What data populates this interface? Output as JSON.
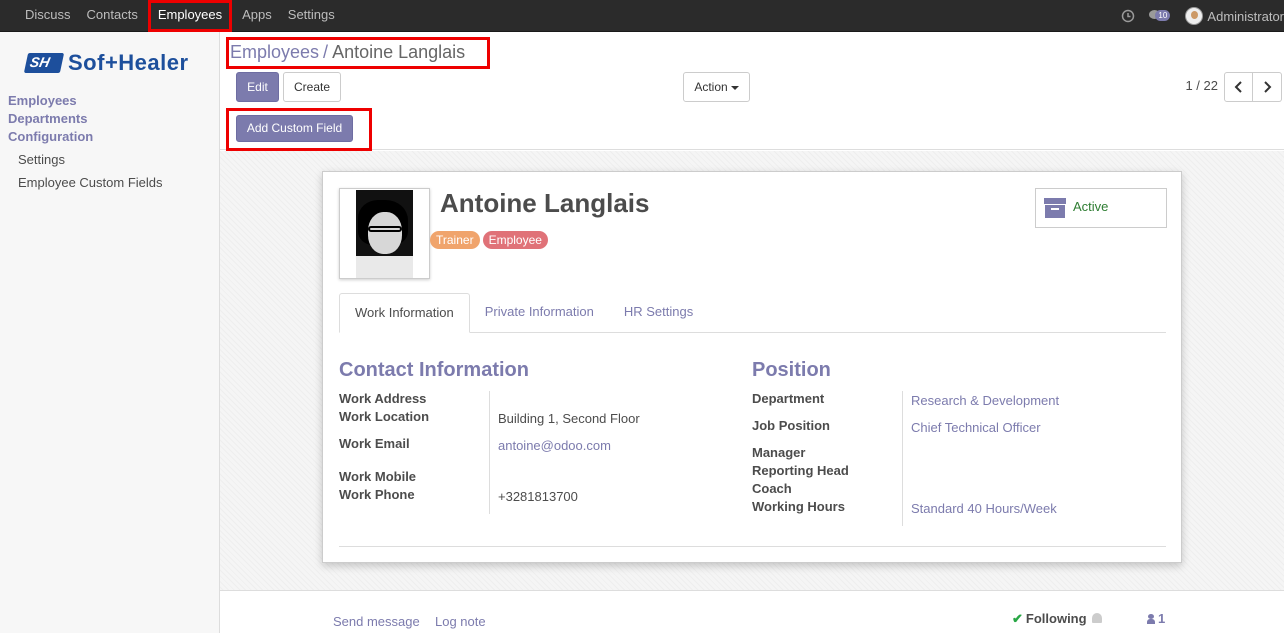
{
  "topnav": {
    "items": [
      "Discuss",
      "Contacts",
      "Employees",
      "Apps",
      "Settings"
    ],
    "active": "Employees",
    "chat_count": "10",
    "user": "Administrator"
  },
  "sidebar": {
    "logo_text": "Sof+Healer",
    "logo_mark": "SH",
    "sections": [
      "Employees",
      "Departments",
      "Configuration"
    ],
    "sub_items": [
      "Settings",
      "Employee Custom Fields"
    ]
  },
  "control_panel": {
    "breadcrumb_parent": "Employees",
    "breadcrumb_sep": "/",
    "breadcrumb_current": "Antoine Langlais",
    "edit_label": "Edit",
    "create_label": "Create",
    "action_label": "Action",
    "pager": "1 / 22",
    "add_custom_field_label": "Add Custom Field"
  },
  "employee": {
    "name": "Antoine Langlais",
    "tags": [
      "Trainer",
      "Employee"
    ],
    "status": "Active",
    "tabs": [
      "Work Information",
      "Private Information",
      "HR Settings"
    ],
    "contact": {
      "title": "Contact Information",
      "work_address_label": "Work Address",
      "work_location_label": "Work Location",
      "work_location": "Building 1, Second Floor",
      "work_email_label": "Work Email",
      "work_email": "antoine@odoo.com",
      "work_mobile_label": "Work Mobile",
      "work_phone_label": "Work Phone",
      "work_phone": "+3281813700"
    },
    "position": {
      "title": "Position",
      "department_label": "Department",
      "department": "Research & Development",
      "job_label": "Job Position",
      "job": "Chief Technical Officer",
      "manager_label": "Manager",
      "reporting_head_label": "Reporting Head",
      "coach_label": "Coach",
      "working_hours_label": "Working Hours",
      "working_hours": "Standard 40 Hours/Week"
    }
  },
  "chatter": {
    "send_message": "Send message",
    "log_note": "Log note",
    "following": "Following",
    "followers_count": "1"
  },
  "colors": {
    "accent": "#7c7bad",
    "topbar": "#2b2b2b",
    "highlight": "#ee0000",
    "active_status": "#2e7d32"
  },
  "icons": [
    "clock-icon",
    "chat-icon",
    "avatar",
    "caret-down-icon",
    "chevron-left-icon",
    "chevron-right-icon",
    "archive-icon",
    "check-icon",
    "bell-icon",
    "user-icon"
  ]
}
